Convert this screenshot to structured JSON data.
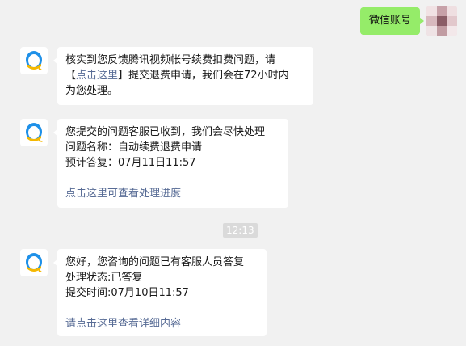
{
  "outgoing": {
    "text": "微信账号"
  },
  "messages": [
    {
      "line1": "核实到您反馈腾讯视频帐号续费扣费问题，请",
      "line2_pre": "【",
      "line2_link": "点击这里",
      "line2_post": "】提交退费申请，我们会在72小时内",
      "line3": "为您处理。"
    },
    {
      "line1": "您提交的问题客服已收到，我们会尽快处理",
      "line2": "问题名称：自动续费退费申请",
      "line3": "预计答复：07月11日11:57",
      "link": "点击这里可查看处理进度"
    },
    {
      "line1": "您好，您咨询的问题已有客服人员答复",
      "line2": "处理状态:已答复",
      "line3": "提交时间:07月10日11:57",
      "link": "请点击这里查看详细内容"
    }
  ],
  "timestamp": "12:13",
  "colors": {
    "background": "#f1f1f1",
    "outgoing_bubble": "#95ec69",
    "incoming_bubble": "#ffffff",
    "link": "#576b95",
    "qq_blue": "#1e90e8",
    "qq_yellow": "#f5b800"
  },
  "icons": {
    "service_avatar": "qq-service-icon",
    "user_avatar": "user-avatar-mosaic"
  }
}
